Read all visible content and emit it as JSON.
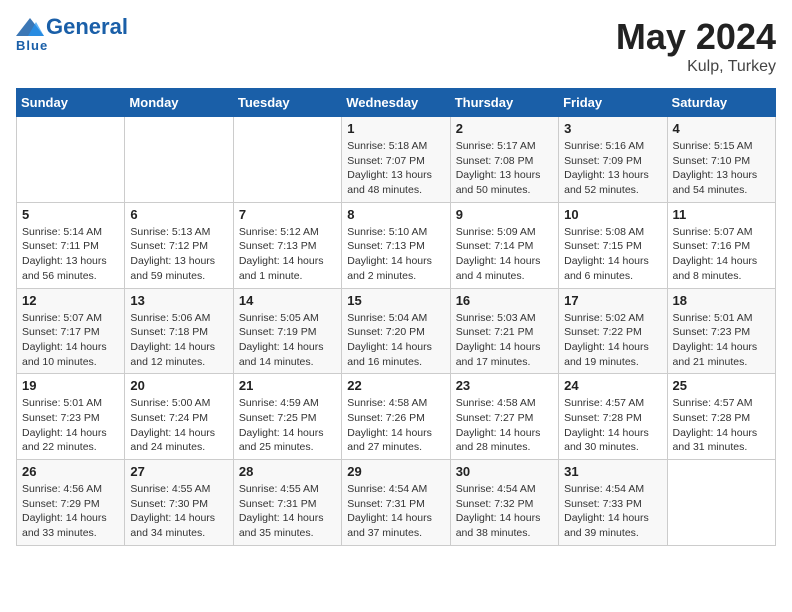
{
  "header": {
    "logo_line1": "General",
    "logo_line2": "Blue",
    "month": "May 2024",
    "location": "Kulp, Turkey"
  },
  "weekdays": [
    "Sunday",
    "Monday",
    "Tuesday",
    "Wednesday",
    "Thursday",
    "Friday",
    "Saturday"
  ],
  "weeks": [
    [
      {
        "day": "",
        "info": ""
      },
      {
        "day": "",
        "info": ""
      },
      {
        "day": "",
        "info": ""
      },
      {
        "day": "1",
        "info": "Sunrise: 5:18 AM\nSunset: 7:07 PM\nDaylight: 13 hours\nand 48 minutes."
      },
      {
        "day": "2",
        "info": "Sunrise: 5:17 AM\nSunset: 7:08 PM\nDaylight: 13 hours\nand 50 minutes."
      },
      {
        "day": "3",
        "info": "Sunrise: 5:16 AM\nSunset: 7:09 PM\nDaylight: 13 hours\nand 52 minutes."
      },
      {
        "day": "4",
        "info": "Sunrise: 5:15 AM\nSunset: 7:10 PM\nDaylight: 13 hours\nand 54 minutes."
      }
    ],
    [
      {
        "day": "5",
        "info": "Sunrise: 5:14 AM\nSunset: 7:11 PM\nDaylight: 13 hours\nand 56 minutes."
      },
      {
        "day": "6",
        "info": "Sunrise: 5:13 AM\nSunset: 7:12 PM\nDaylight: 13 hours\nand 59 minutes."
      },
      {
        "day": "7",
        "info": "Sunrise: 5:12 AM\nSunset: 7:13 PM\nDaylight: 14 hours\nand 1 minute."
      },
      {
        "day": "8",
        "info": "Sunrise: 5:10 AM\nSunset: 7:13 PM\nDaylight: 14 hours\nand 2 minutes."
      },
      {
        "day": "9",
        "info": "Sunrise: 5:09 AM\nSunset: 7:14 PM\nDaylight: 14 hours\nand 4 minutes."
      },
      {
        "day": "10",
        "info": "Sunrise: 5:08 AM\nSunset: 7:15 PM\nDaylight: 14 hours\nand 6 minutes."
      },
      {
        "day": "11",
        "info": "Sunrise: 5:07 AM\nSunset: 7:16 PM\nDaylight: 14 hours\nand 8 minutes."
      }
    ],
    [
      {
        "day": "12",
        "info": "Sunrise: 5:07 AM\nSunset: 7:17 PM\nDaylight: 14 hours\nand 10 minutes."
      },
      {
        "day": "13",
        "info": "Sunrise: 5:06 AM\nSunset: 7:18 PM\nDaylight: 14 hours\nand 12 minutes."
      },
      {
        "day": "14",
        "info": "Sunrise: 5:05 AM\nSunset: 7:19 PM\nDaylight: 14 hours\nand 14 minutes."
      },
      {
        "day": "15",
        "info": "Sunrise: 5:04 AM\nSunset: 7:20 PM\nDaylight: 14 hours\nand 16 minutes."
      },
      {
        "day": "16",
        "info": "Sunrise: 5:03 AM\nSunset: 7:21 PM\nDaylight: 14 hours\nand 17 minutes."
      },
      {
        "day": "17",
        "info": "Sunrise: 5:02 AM\nSunset: 7:22 PM\nDaylight: 14 hours\nand 19 minutes."
      },
      {
        "day": "18",
        "info": "Sunrise: 5:01 AM\nSunset: 7:23 PM\nDaylight: 14 hours\nand 21 minutes."
      }
    ],
    [
      {
        "day": "19",
        "info": "Sunrise: 5:01 AM\nSunset: 7:23 PM\nDaylight: 14 hours\nand 22 minutes."
      },
      {
        "day": "20",
        "info": "Sunrise: 5:00 AM\nSunset: 7:24 PM\nDaylight: 14 hours\nand 24 minutes."
      },
      {
        "day": "21",
        "info": "Sunrise: 4:59 AM\nSunset: 7:25 PM\nDaylight: 14 hours\nand 25 minutes."
      },
      {
        "day": "22",
        "info": "Sunrise: 4:58 AM\nSunset: 7:26 PM\nDaylight: 14 hours\nand 27 minutes."
      },
      {
        "day": "23",
        "info": "Sunrise: 4:58 AM\nSunset: 7:27 PM\nDaylight: 14 hours\nand 28 minutes."
      },
      {
        "day": "24",
        "info": "Sunrise: 4:57 AM\nSunset: 7:28 PM\nDaylight: 14 hours\nand 30 minutes."
      },
      {
        "day": "25",
        "info": "Sunrise: 4:57 AM\nSunset: 7:28 PM\nDaylight: 14 hours\nand 31 minutes."
      }
    ],
    [
      {
        "day": "26",
        "info": "Sunrise: 4:56 AM\nSunset: 7:29 PM\nDaylight: 14 hours\nand 33 minutes."
      },
      {
        "day": "27",
        "info": "Sunrise: 4:55 AM\nSunset: 7:30 PM\nDaylight: 14 hours\nand 34 minutes."
      },
      {
        "day": "28",
        "info": "Sunrise: 4:55 AM\nSunset: 7:31 PM\nDaylight: 14 hours\nand 35 minutes."
      },
      {
        "day": "29",
        "info": "Sunrise: 4:54 AM\nSunset: 7:31 PM\nDaylight: 14 hours\nand 37 minutes."
      },
      {
        "day": "30",
        "info": "Sunrise: 4:54 AM\nSunset: 7:32 PM\nDaylight: 14 hours\nand 38 minutes."
      },
      {
        "day": "31",
        "info": "Sunrise: 4:54 AM\nSunset: 7:33 PM\nDaylight: 14 hours\nand 39 minutes."
      },
      {
        "day": "",
        "info": ""
      }
    ]
  ]
}
